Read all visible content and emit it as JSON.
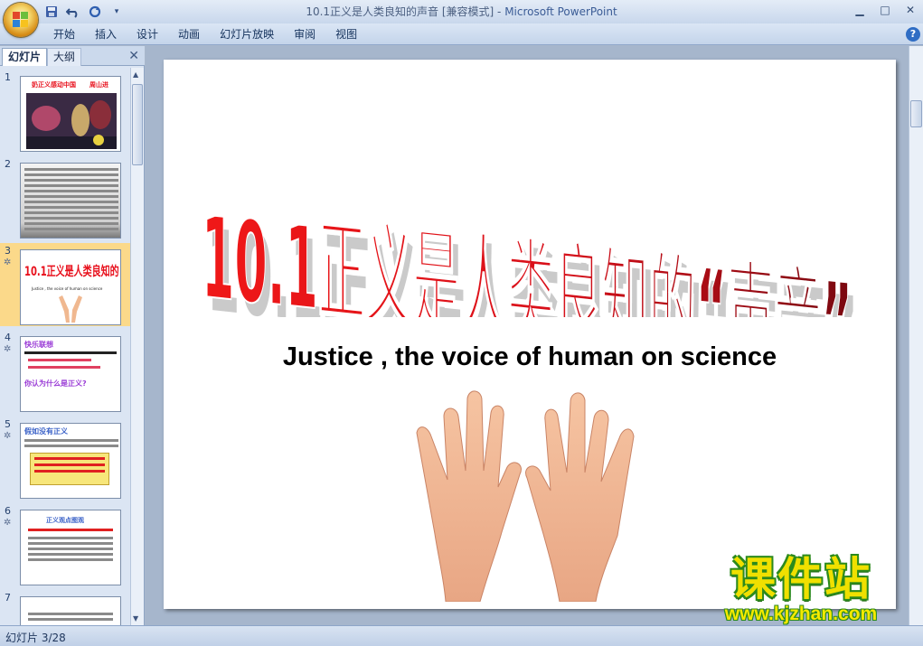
{
  "window": {
    "title": "10.1正义是人类良知的声音 [兼容模式]",
    "app_name": "Microsoft PowerPoint",
    "separator": " - "
  },
  "quick_access": {
    "icons": [
      "save-icon",
      "undo-icon",
      "redo-icon",
      "customize-icon"
    ]
  },
  "ribbon": {
    "tabs": [
      "开始",
      "插入",
      "设计",
      "动画",
      "幻灯片放映",
      "审阅",
      "视图"
    ],
    "help_label": "?"
  },
  "panel": {
    "tab_slides": "幻灯片",
    "tab_outline": "大纲",
    "close_label": "✕"
  },
  "thumbnails": [
    {
      "number": "1",
      "title": "奶正义感动中国",
      "title_right": "周山进"
    },
    {
      "number": "2"
    },
    {
      "number": "3",
      "title": "10.1正义是人类良知的 “声音”",
      "subtitle": "Justice , the voice of human on science",
      "selected": true
    },
    {
      "number": "4",
      "title": "快乐联想",
      "heading2": "你认为什么是正义?"
    },
    {
      "number": "5",
      "title": "假如没有正义"
    },
    {
      "number": "6",
      "title": "正义观点图观"
    },
    {
      "number": "7"
    }
  ],
  "slide": {
    "title": "10.1正义是人类良知的“声音”",
    "subtitle": "Justice , the voice of human on science",
    "colors": {
      "title_red": "#e8101c",
      "title_dark": "#8a0a10"
    }
  },
  "watermark": {
    "brand": "课件站",
    "url": "www.kjzhan.com"
  },
  "status": {
    "slide_info": "幻灯片 3/28"
  }
}
